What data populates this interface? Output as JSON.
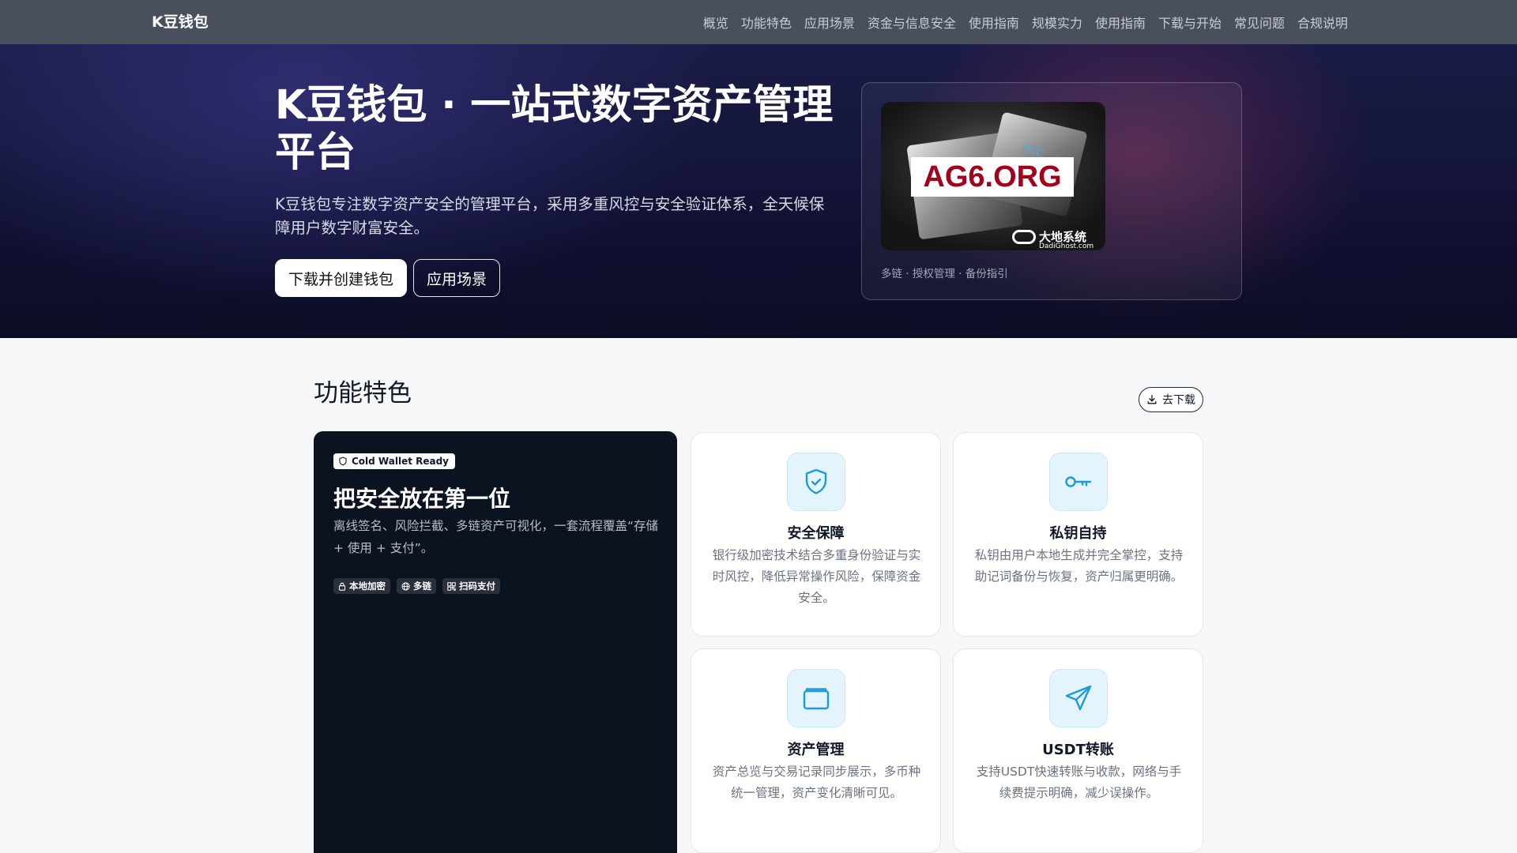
{
  "nav": {
    "brand": "K豆钱包",
    "links": [
      "概览",
      "功能特色",
      "应用场景",
      "资金与信息安全",
      "使用指南",
      "规模实力",
      "使用指南",
      "下载与开始",
      "常见问题",
      "合规说明"
    ]
  },
  "hero": {
    "title": "K豆钱包 · 一站式数字资产管理平台",
    "subtitle": "K豆钱包专注数字资产安全的管理平台，采用多重风控与安全验证体系，全天候保障用户数字财富安全。",
    "primary_button": "下载并创建钱包",
    "secondary_button": "应用场景",
    "image": {
      "overlay_text": "AG6.ORG",
      "chip_text": "BTC",
      "watermark": "大地系统",
      "watermark_sub": "DadiGhost.com"
    },
    "caption": "多链 · 授权管理 · 备份指引"
  },
  "features": {
    "title": "功能特色",
    "download_button": "去下载",
    "highlight": {
      "badge": "Cold Wallet Ready",
      "title": "把安全放在第一位",
      "description": "离线签名、风险拦截、多链资产可视化，一套流程覆盖“存储 + 使用 + 支付”。",
      "tags": [
        {
          "icon": "lock-icon",
          "label": "本地加密"
        },
        {
          "icon": "globe-icon",
          "label": "多链"
        },
        {
          "icon": "qr-code-icon",
          "label": "扫码支付"
        }
      ]
    },
    "cards": [
      {
        "icon": "shield-check-icon",
        "title": "安全保障",
        "description": "银行级加密技术结合多重身份验证与实时风控，降低异常操作风险，保障资金安全。"
      },
      {
        "icon": "key-icon",
        "title": "私钥自持",
        "description": "私钥由用户本地生成并完全掌控，支持助记词备份与恢复，资产归属更明确。"
      },
      {
        "icon": "wallet-icon",
        "title": "资产管理",
        "description": "资产总览与交易记录同步展示，多币种统一管理，资产变化清晰可见。"
      },
      {
        "icon": "send-icon",
        "title": "USDT转账",
        "description": "支持USDT快速转账与收款，网络与手续费提示明确，减少误操作。"
      }
    ]
  },
  "colors": {
    "nav_bg": "#4a4f5c",
    "hero_bg": "#14153a",
    "dark_card_bg": "#0b1220",
    "icon_accent": "#1e9bd7",
    "icon_bg": "#e3f4fd"
  }
}
